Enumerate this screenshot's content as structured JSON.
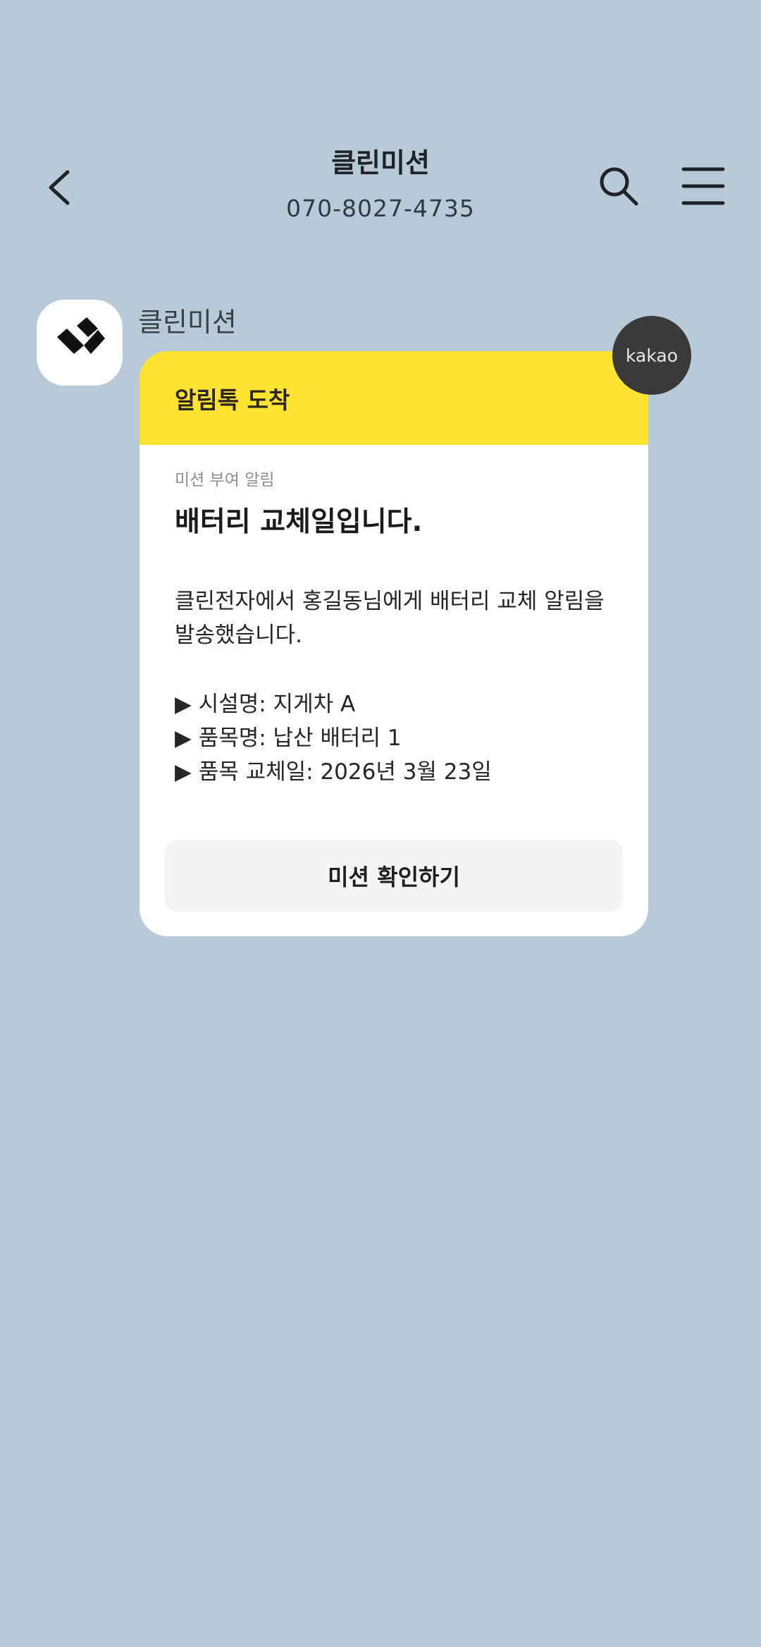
{
  "header": {
    "title": "클린미션",
    "phone": "070-8027-4735"
  },
  "sender": {
    "name": "클린미션"
  },
  "card": {
    "header_label": "알림톡 도착",
    "subtitle": "미션 부여 알림",
    "title": "배터리 교체일입니다.",
    "description": "클린전자에서 홍길동님에게 배터리 교체 알림을 발송했습니다.",
    "details": [
      "▶ 시설명: 지게차 A",
      "▶ 품목명: 납산 배터리 1",
      "▶ 품목 교체일: 2026년 3월 23일"
    ],
    "button_label": "미션 확인하기"
  },
  "badge": {
    "label": "kakao"
  },
  "icons": {
    "back": "chevron-left-icon",
    "search": "search-icon",
    "menu": "hamburger-menu-icon",
    "avatar": "brand-logo-icon"
  },
  "colors": {
    "background": "#b8c9d8",
    "card_header": "#fce431",
    "badge": "#3a3a3a"
  }
}
